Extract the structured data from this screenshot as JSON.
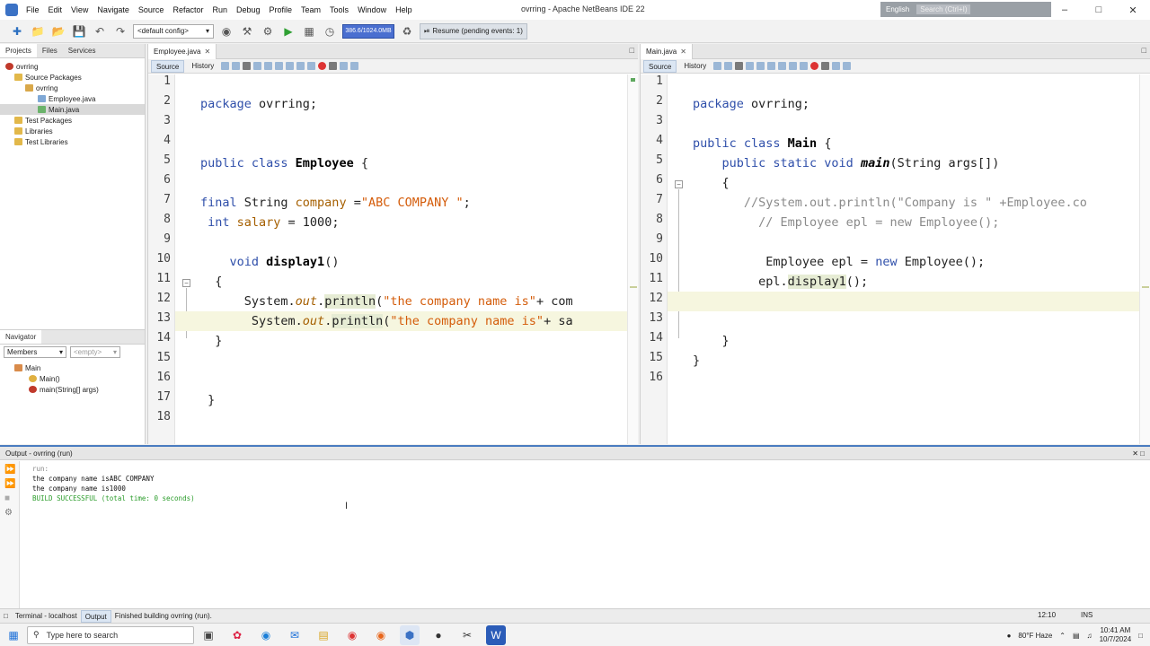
{
  "window": {
    "title": "ovrring - Apache NetBeans IDE 22",
    "menus": [
      "File",
      "Edit",
      "View",
      "Navigate",
      "Source",
      "Refactor",
      "Run",
      "Debug",
      "Profile",
      "Team",
      "Tools",
      "Window",
      "Help"
    ],
    "lang_label": "English",
    "search_placeholder": "Search (Ctrl+I)"
  },
  "toolbar": {
    "config": "<default config>",
    "memory": "386.6/1024.0MB",
    "resume": "Resume (pending events: 1)"
  },
  "projects_panel": {
    "tabs": [
      "Projects",
      "Files",
      "Services"
    ],
    "tree": [
      {
        "label": "ovrring",
        "level": 0
      },
      {
        "label": "Source Packages",
        "level": 1
      },
      {
        "label": "ovrring",
        "level": 2
      },
      {
        "label": "Employee.java",
        "level": 3
      },
      {
        "label": "Main.java",
        "level": 3
      },
      {
        "label": "Test Packages",
        "level": 1
      },
      {
        "label": "Libraries",
        "level": 1
      },
      {
        "label": "Test Libraries",
        "level": 1
      }
    ]
  },
  "navigator": {
    "tab": "Navigator",
    "members_label": "Members",
    "filter_label": "<empty>",
    "root": "Main",
    "items": [
      "Main()",
      "main(String[] args)"
    ]
  },
  "editor_left": {
    "tab": "Employee.java",
    "source_label": "Source",
    "history_label": "History",
    "line_numbers": [
      "1",
      "2",
      "3",
      "4",
      "5",
      "6",
      "7",
      "8",
      "9",
      "10",
      "11",
      "12",
      "13",
      "14",
      "15",
      "16",
      "17",
      "18"
    ]
  },
  "editor_right": {
    "tab": "Main.java",
    "source_label": "Source",
    "history_label": "History",
    "line_numbers": [
      "1",
      "2",
      "3",
      "4",
      "5",
      "6",
      "7",
      "8",
      "9",
      "10",
      "11",
      "12",
      "13",
      "14",
      "15",
      "16"
    ]
  },
  "code_left": {
    "pkg_kw": "package",
    "pkg_name": " ovrring;",
    "cls_kw": "public class ",
    "cls_name": "Employee",
    "cls_brace": " {",
    "final_kw": "final",
    "string_type": " String ",
    "company_field": "company",
    "company_assign": " =",
    "company_value": "\"ABC COMPANY \"",
    "semi": ";",
    "int_kw": " int",
    "salary_field": " salary",
    "salary_assign": " = 1000;",
    "void_kw": "    void ",
    "method_name": "display1",
    "method_parens": "()",
    "open_brace": "  {",
    "l12_a": "      System.",
    "l12_out": "out",
    "l12_dot": ".",
    "l12_call": "println",
    "l12_b": "(",
    "l12_str": "\"the company name is\"",
    "l12_c": "+ com",
    "l13_a": "       System.",
    "l13_out": "out",
    "l13_dot": ".",
    "l13_call": "println",
    "l13_b": "(",
    "l13_str": "\"the company name is\"",
    "l13_c": "+ sa",
    "close_brace_14": "  }",
    "close_brace_17": " }"
  },
  "code_right": {
    "pkg_kw": "package",
    "pkg_name": " ovrring;",
    "cls_kw": "public class ",
    "cls_name": "Main",
    "cls_brace": " {",
    "main_kw": "    public static void ",
    "main_name": "main",
    "main_args": "(String args[])",
    "open_brace": "    {",
    "cmt7": "       //System.out.println(\"Company is \" +Employee.co",
    "cmt8": "         // Employee epl = new Employee();",
    "l10_a": "          Employee epl = ",
    "l10_new": "new",
    "l10_b": " Employee();",
    "l11_a": "         epl.",
    "l11_call": "display1",
    "l11_b": "();",
    "close14": "    }",
    "close15": "}"
  },
  "output": {
    "title": "Output - ovrring (run)",
    "lines": [
      {
        "text": "run:",
        "style": "gray"
      },
      {
        "text": "the company name isABC COMPANY",
        "style": "black"
      },
      {
        "text": "the company name is1000",
        "style": "black"
      },
      {
        "text": "BUILD SUCCESSFUL (total time: 0 seconds)",
        "style": "green"
      }
    ]
  },
  "statusbar": {
    "terminal": "Terminal - localhost",
    "output": "Output",
    "message": "Finished building ovrring (run).",
    "position": "12:10",
    "mode": "INS"
  },
  "taskbar": {
    "search_placeholder": "Type here to search",
    "weather": "80°F  Haze",
    "time": "10:41 AM",
    "date": "10/7/2024"
  }
}
